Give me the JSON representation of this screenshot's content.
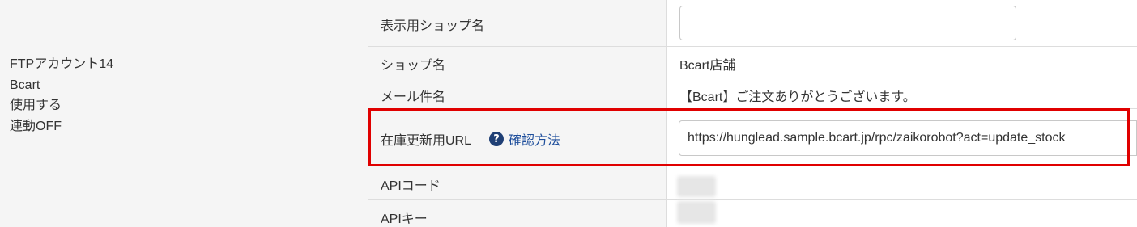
{
  "account": {
    "lines": [
      "FTPアカウント14",
      "Bcart",
      "使用する",
      "連動OFF"
    ]
  },
  "rows": {
    "display_shop_name": {
      "label": "表示用ショップ名",
      "value": "",
      "placeholder": ""
    },
    "shop_name": {
      "label": "ショップ名",
      "value": "Bcart店舗"
    },
    "mail_subject": {
      "label": "メール件名",
      "value": "【Bcart】ご注文ありがとうございます。"
    },
    "stock_update_url": {
      "label": "在庫更新用URL",
      "help_icon": "question-circle-icon",
      "help_text": "確認方法",
      "value": "https://hunglead.sample.bcart.jp/rpc/zaikorobot?act=update_stock"
    },
    "api_code": {
      "label": "APIコード"
    },
    "api_key": {
      "label": "APIキー"
    }
  },
  "colors": {
    "highlight": "#e00000",
    "label_bg": "#f5f5f5",
    "link": "#1f4f9c",
    "help_icon_bg": "#1f3f75"
  }
}
